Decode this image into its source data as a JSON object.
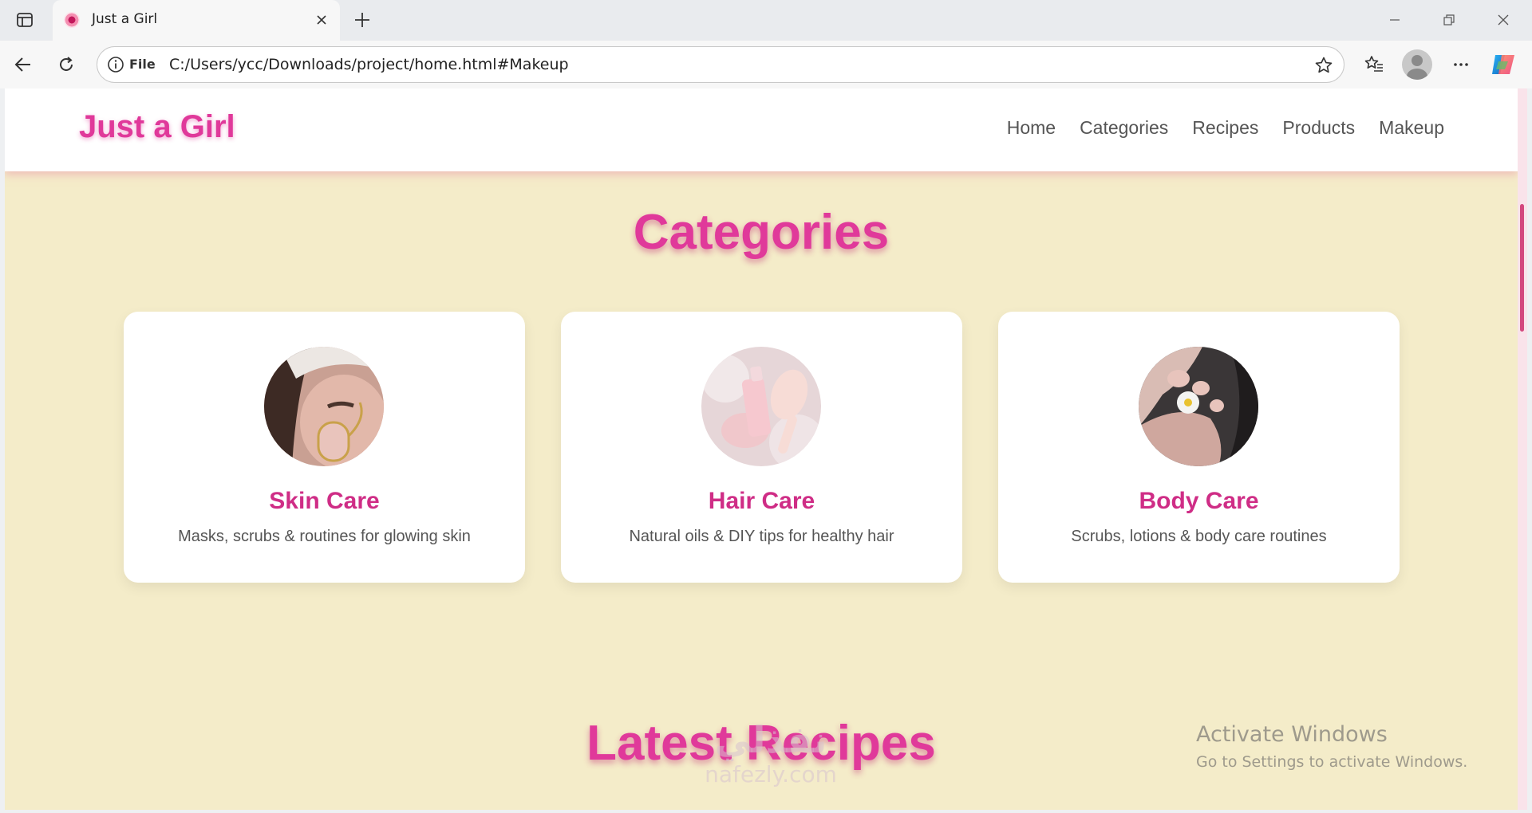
{
  "browser": {
    "tab_title": "Just a Girl",
    "file_label": "File",
    "url": "C:/Users/ycc/Downloads/project/home.html#Makeup"
  },
  "site": {
    "logo": "Just a Girl",
    "nav": [
      "Home",
      "Categories",
      "Recipes",
      "Products",
      "Makeup"
    ]
  },
  "categories_section": {
    "title": "Categories",
    "cards": [
      {
        "title": "Skin Care",
        "description": "Masks, scrubs & routines for glowing skin",
        "image": "face-mask-roller-photo"
      },
      {
        "title": "Hair Care",
        "description": "Natural oils & DIY tips for healthy hair",
        "image": "hair-brush-bottle-photo"
      },
      {
        "title": "Body Care",
        "description": "Scrubs, lotions & body care routines",
        "image": "foot-flower-photo"
      }
    ]
  },
  "recipes_section": {
    "title": "Latest Recipes"
  },
  "os_notice": {
    "title": "Activate Windows",
    "subtitle": "Go to Settings to activate Windows."
  },
  "watermark": {
    "top": "نفذلي",
    "bottom": "nafezly.com"
  },
  "colors": {
    "brand_pink": "#e0399a",
    "page_bg": "#f4ecc9",
    "card_title": "#cf2d86"
  }
}
